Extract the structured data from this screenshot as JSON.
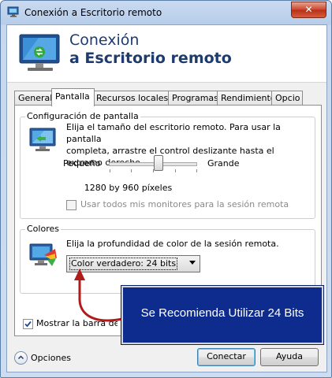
{
  "window": {
    "title": "Conexión a Escritorio remoto",
    "close_glyph": "✕"
  },
  "banner": {
    "line1": "Conexión",
    "line2": "a Escritorio remoto",
    "icon": "remote-desktop-icon"
  },
  "tabs": [
    {
      "label": "General",
      "active": false
    },
    {
      "label": "Pantalla",
      "active": true
    },
    {
      "label": "Recursos locales",
      "active": false
    },
    {
      "label": "Programas",
      "active": false
    },
    {
      "label": "Rendimiento",
      "active": false
    },
    {
      "label": "Opcio",
      "active": false
    }
  ],
  "display_config": {
    "title": "Configuración de pantalla",
    "description_line1": "Elija el tamaño del escritorio remoto. Para usar la pantalla",
    "description_line2": "completa, arrastre el control deslizante hasta el extremo derecho.",
    "slider_min_label": "Pequeño",
    "slider_max_label": "Grande",
    "slider_value_fraction": 0.57,
    "resolution": "1280 by 960 píxeles",
    "use_all_monitors_label": "Usar todos mis monitores para la sesión remota",
    "use_all_monitors_checked": false,
    "use_all_monitors_enabled": false
  },
  "colors": {
    "title": "Colores",
    "description": "Elija la profundidad de color de la sesión remota.",
    "selected": "Color verdadero: 24 bits"
  },
  "connection_bar": {
    "label": "Mostrar la barra de conexión",
    "checked": true
  },
  "footer": {
    "options_label": "Opciones",
    "connect_label": "Conectar",
    "help_label": "Ayuda"
  },
  "annotation": {
    "text": "Se Recomienda Utilizar 24 Bits",
    "box_color": "#0e2c8e",
    "arrow_color": "#b01c1c"
  }
}
